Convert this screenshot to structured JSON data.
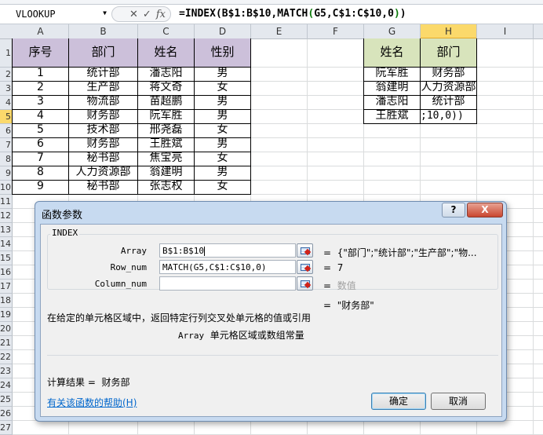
{
  "formula_bar": {
    "name_box": "VLOOKUP",
    "cancel_icon": "✕",
    "enter_icon": "✓",
    "fx_label": "fx",
    "formula_parts": [
      "=INDEX(B$1:B$10,MATCH",
      "(",
      "G5,C$1:C$10,0",
      ")",
      ")"
    ]
  },
  "columns": [
    "A",
    "B",
    "C",
    "D",
    "E",
    "F",
    "G",
    "H",
    "I"
  ],
  "rows": [
    "1",
    "2",
    "3",
    "4",
    "5",
    "6",
    "7",
    "8",
    "9",
    "10",
    "11",
    "12",
    "13",
    "14",
    "15",
    "16",
    "17",
    "18",
    "19",
    "20",
    "21",
    "22",
    "23",
    "24",
    "25",
    "26",
    "27"
  ],
  "table1": {
    "headers": [
      "序号",
      "部门",
      "姓名",
      "性别"
    ],
    "rows": [
      [
        "1",
        "统计部",
        "潘志阳",
        "男"
      ],
      [
        "2",
        "生产部",
        "蒋文奇",
        "女"
      ],
      [
        "3",
        "物流部",
        "苗超鹏",
        "男"
      ],
      [
        "4",
        "财务部",
        "阮军胜",
        "男"
      ],
      [
        "5",
        "技术部",
        "邢尧磊",
        "女"
      ],
      [
        "6",
        "财务部",
        "王胜斌",
        "男"
      ],
      [
        "7",
        "秘书部",
        "焦宝亮",
        "女"
      ],
      [
        "8",
        "人力资源部",
        "翁建明",
        "男"
      ],
      [
        "9",
        "秘书部",
        "张志权",
        "女"
      ]
    ]
  },
  "table2": {
    "headers": [
      "姓名",
      "部门"
    ],
    "rows": [
      [
        "阮军胜",
        "财务部"
      ],
      [
        "翁建明",
        "人力资源部"
      ],
      [
        "潘志阳",
        "统计部"
      ],
      [
        "王胜斌",
        ";10,0))"
      ]
    ]
  },
  "dialog": {
    "title": "函数参数",
    "help_btn": "?",
    "close_btn": "X",
    "function_name": "INDEX",
    "params": [
      {
        "label": "Array",
        "value": "B$1:B$10",
        "eq": "=",
        "result": "{\"部门\";\"统计部\";\"生产部\";\"物..."
      },
      {
        "label": "Row_num",
        "value": "MATCH(G5,C$1:C$10,0)",
        "eq": "=",
        "result": "7"
      },
      {
        "label": "Column_num",
        "value": "",
        "eq": "=",
        "result": "数值"
      }
    ],
    "overall_eq": "=",
    "overall_result": "\"财务部\"",
    "description": "在给定的单元格区域中，返回特定行列交叉处单元格的值或引用",
    "param_help_name": "Array",
    "param_help_text": "单元格区域或数组常量",
    "calc_label": "计算结果 =",
    "calc_value": "财务部",
    "help_link": "有关该函数的帮助(H)",
    "ok": "确定",
    "cancel": "取消"
  }
}
